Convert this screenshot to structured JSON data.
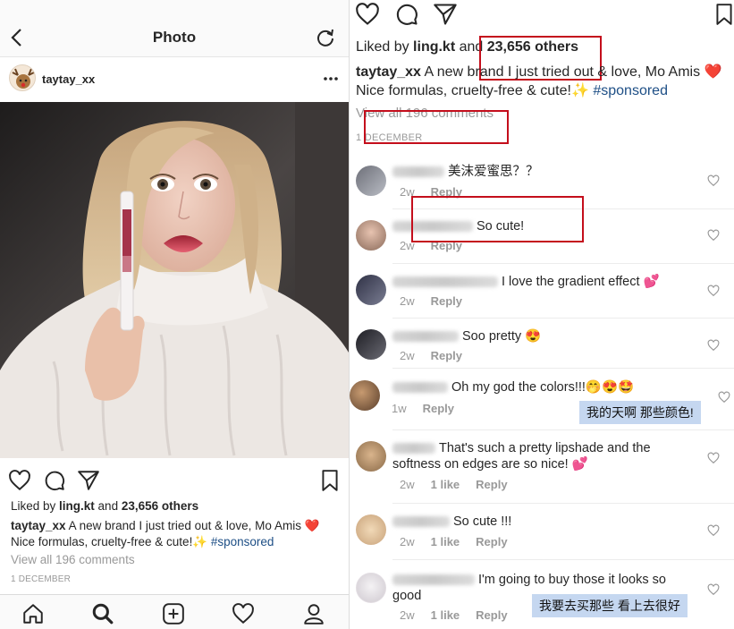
{
  "left": {
    "screen_title": "Photo",
    "username": "taytay_xx",
    "likes": {
      "prefix": "Liked by ",
      "user": "ling.kt",
      "and": " and ",
      "others": "23,656 others"
    },
    "caption": {
      "user": "taytay_xx",
      "text": " A new brand I just tried out & love, Mo Amis ❤️ Nice formulas, cruelty-free & cute!✨ ",
      "hashtag": "#sponsored"
    },
    "view_all": "View all 196 comments",
    "date": "1 DECEMBER",
    "tabs": [
      "home-icon",
      "search-icon",
      "add-post-icon",
      "activity-heart-icon",
      "profile-icon"
    ]
  },
  "right": {
    "likes": {
      "prefix": "Liked by ",
      "user": "ling.kt",
      "and": " and ",
      "others": "23,656 others"
    },
    "caption": {
      "user": "taytay_xx",
      "text": " A new brand I just tried out & love, Mo Amis ❤️ Nice formulas, cruelty-free & cute!✨ ",
      "hashtag": "#sponsored"
    },
    "view_all": "View all 196 comments",
    "date": "1 DECEMBER",
    "comments": [
      {
        "text": "美沫爱蜜思？？",
        "time": "2w",
        "likes": "",
        "reply": "Reply"
      },
      {
        "text": "So cute!",
        "time": "2w",
        "likes": "",
        "reply": "Reply"
      },
      {
        "text": "I love the gradient effect 💕",
        "time": "2w",
        "likes": "",
        "reply": "Reply"
      },
      {
        "text": "Soo pretty 😍",
        "time": "2w",
        "likes": "",
        "reply": "Reply"
      },
      {
        "text": "Oh my god the colors!!!🤭😍🤩",
        "time": "1w",
        "likes": "",
        "reply": "Reply"
      },
      {
        "text": "That's such a pretty lipshade and the softness on edges are so nice! 💕",
        "time": "2w",
        "likes": "1 like",
        "reply": "Reply"
      },
      {
        "text": "So cute !!!",
        "time": "2w",
        "likes": "1 like",
        "reply": "Reply"
      },
      {
        "text": "I'm going to buy those it looks so good",
        "time": "2w",
        "likes": "1 like",
        "reply": "Reply"
      }
    ],
    "translations": [
      "我的天啊 那些颜色!",
      "我要去买那些 看上去很好"
    ]
  },
  "colors": {
    "highlight": "#c40e1c",
    "hashtag": "#1e4f86",
    "translation_bg": "#c5d7f0"
  }
}
